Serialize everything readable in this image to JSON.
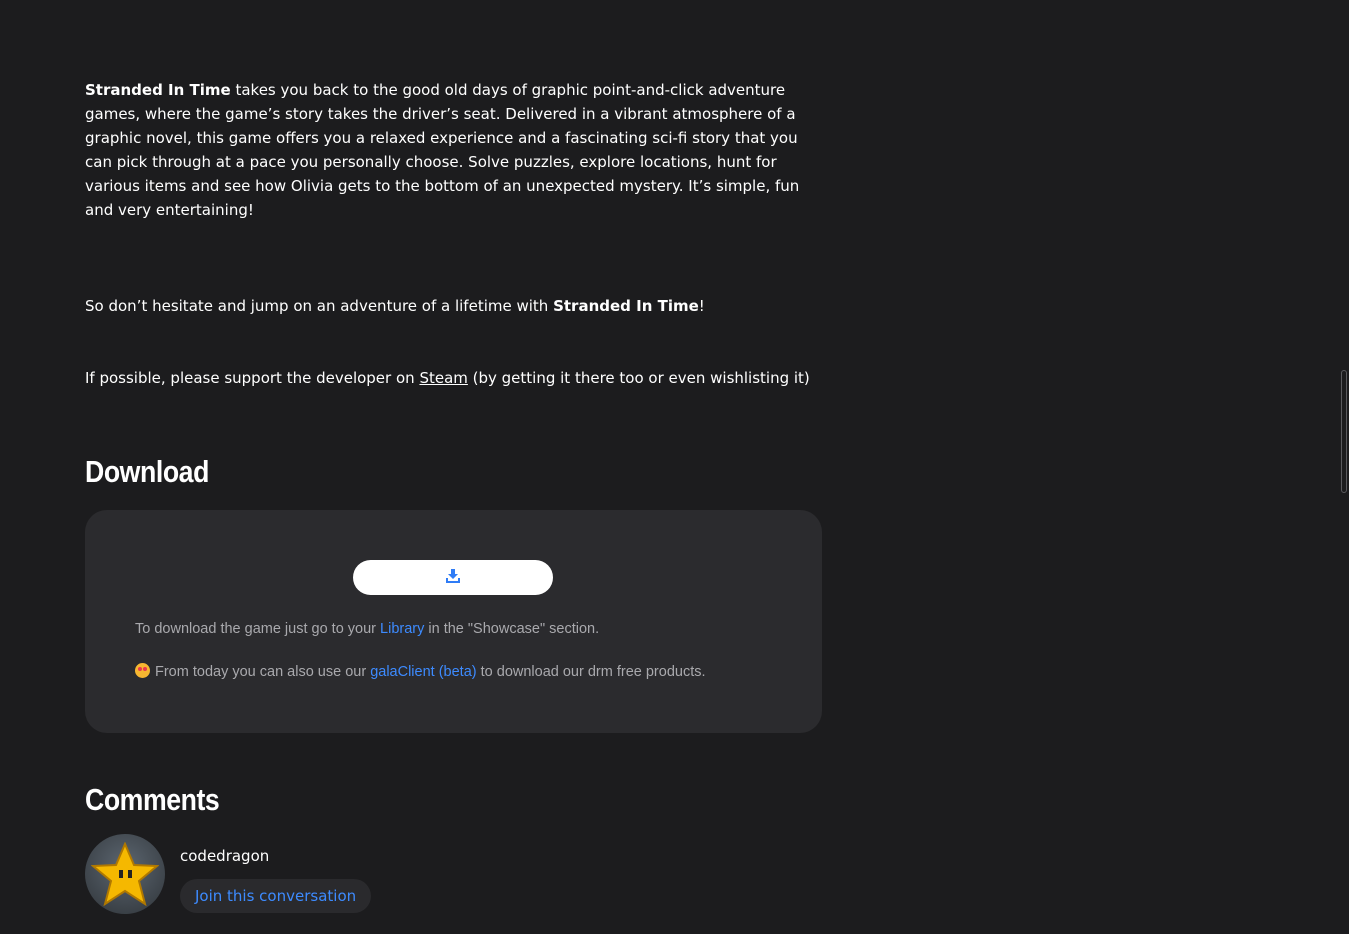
{
  "description": {
    "p1_title": "Stranded In Time",
    "p1_text": " takes you back to the good old days of graphic point-and-click adventure games, where the game’s story takes the driver’s seat. Delivered in a vibrant atmosphere of a graphic novel, this game offers you a relaxed experience and a fascinating sci-fi story that you can pick through at a pace you personally choose. Solve puzzles, explore locations, hunt for various items and see how Olivia gets to the bottom of an unexpected mystery. It’s simple, fun and very entertaining!",
    "p2_prefix": "So don’t hesitate and jump on an adventure of a lifetime with ",
    "p2_title": "Stranded In Time",
    "p2_suffix": "!",
    "p3_prefix": "If possible, please support the developer on ",
    "p3_link": "Steam",
    "p3_suffix": " (by getting it there too or even wishlisting it)"
  },
  "download": {
    "heading": "Download",
    "button_icon": "download-icon",
    "info_prefix": "To download the game just go to your ",
    "info_link": "Library",
    "info_suffix": " in the \"Showcase\" section.",
    "client_emoji": "star-struck-emoji",
    "client_prefix": "From today you can also use our ",
    "client_link": "galaClient (beta)",
    "client_suffix": " to download our drm free products."
  },
  "comments": {
    "heading": "Comments",
    "user": {
      "avatar_icon": "pixel-star-avatar",
      "name": "codedragon",
      "join_label": "Join this conversation"
    }
  },
  "colors": {
    "background": "#1c1c1e",
    "panel": "#2b2b2e",
    "link_blue": "#3d8bff",
    "muted_text": "#a9a9ad"
  }
}
